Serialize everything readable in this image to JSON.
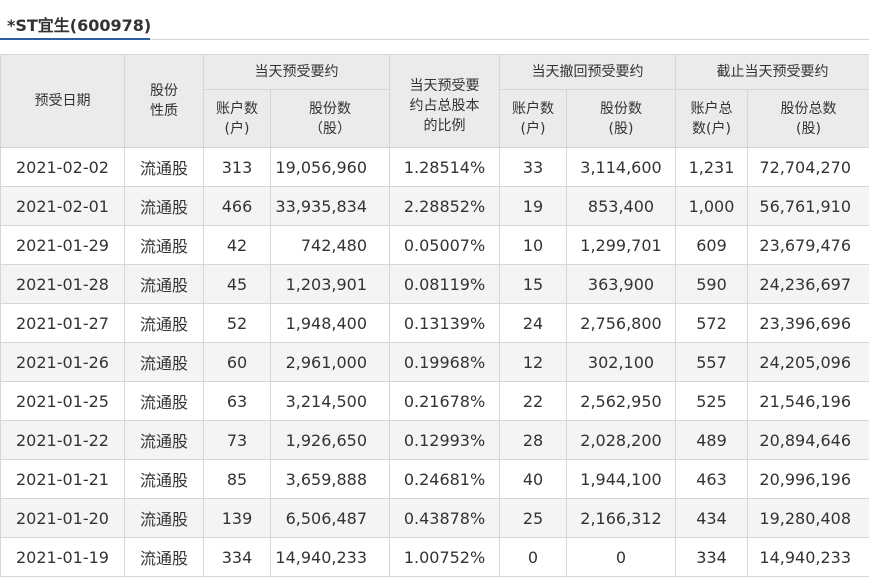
{
  "tab": {
    "title": "*ST宜生(600978)"
  },
  "table": {
    "headers": {
      "date": "预受日期",
      "share_type": "股份性质",
      "today_group": "当天预受要约",
      "today_accounts": "账户数(户)",
      "today_shares": "股份数（股）",
      "today_ratio": "当天预受要约占总股本的比例",
      "withdraw_group": "当天撤回预受要约",
      "withdraw_accounts": "账户数(户)",
      "withdraw_shares": "股份数(股)",
      "cum_group": "截止当天预受要约",
      "cum_accounts": "账户总数(户)",
      "cum_shares": "股份总数(股)"
    },
    "rows": [
      [
        "2021-02-02",
        "流通股",
        "313",
        "19,056,960",
        "1.28514%",
        "33",
        "3,114,600",
        "1,231",
        "72,704,270"
      ],
      [
        "2021-02-01",
        "流通股",
        "466",
        "33,935,834",
        "2.28852%",
        "19",
        "853,400",
        "1,000",
        "56,761,910"
      ],
      [
        "2021-01-29",
        "流通股",
        "42",
        "742,480",
        "0.05007%",
        "10",
        "1,299,701",
        "609",
        "23,679,476"
      ],
      [
        "2021-01-28",
        "流通股",
        "45",
        "1,203,901",
        "0.08119%",
        "15",
        "363,900",
        "590",
        "24,236,697"
      ],
      [
        "2021-01-27",
        "流通股",
        "52",
        "1,948,400",
        "0.13139%",
        "24",
        "2,756,800",
        "572",
        "23,396,696"
      ],
      [
        "2021-01-26",
        "流通股",
        "60",
        "2,961,000",
        "0.19968%",
        "12",
        "302,100",
        "557",
        "24,205,096"
      ],
      [
        "2021-01-25",
        "流通股",
        "63",
        "3,214,500",
        "0.21678%",
        "22",
        "2,562,950",
        "525",
        "21,546,196"
      ],
      [
        "2021-01-22",
        "流通股",
        "73",
        "1,926,650",
        "0.12993%",
        "28",
        "2,028,200",
        "489",
        "20,894,646"
      ],
      [
        "2021-01-21",
        "流通股",
        "85",
        "3,659,888",
        "0.24681%",
        "40",
        "1,944,100",
        "463",
        "20,996,196"
      ],
      [
        "2021-01-20",
        "流通股",
        "139",
        "6,506,487",
        "0.43878%",
        "25",
        "2,166,312",
        "434",
        "19,280,408"
      ],
      [
        "2021-01-19",
        "流通股",
        "334",
        "14,940,233",
        "1.00752%",
        "0",
        "0",
        "334",
        "14,940,233"
      ]
    ]
  }
}
